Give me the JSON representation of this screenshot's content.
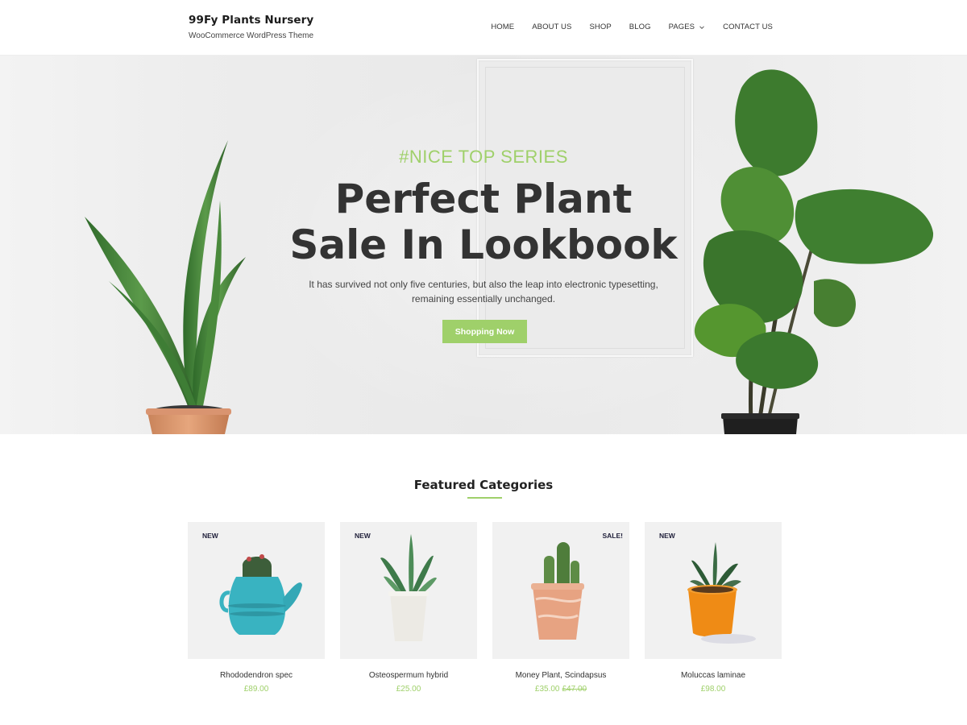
{
  "header": {
    "brand_title": "99Fy Plants Nursery",
    "brand_tagline": "WooCommerce WordPress Theme",
    "nav": [
      {
        "label": "HOME"
      },
      {
        "label": "ABOUT US"
      },
      {
        "label": "SHOP"
      },
      {
        "label": "BLOG"
      },
      {
        "label": "PAGES",
        "has_dropdown": true
      },
      {
        "label": "CONTACT US"
      }
    ]
  },
  "hero": {
    "kicker": "#NICE TOP SERIES",
    "title_line1": "Perfect Plant",
    "title_line2": "Sale In Lookbook",
    "subtitle_line1": "It has survived not only five centuries, but also the leap into electronic typesetting,",
    "subtitle_line2": "remaining essentially unchanged.",
    "button_label": "Shopping Now"
  },
  "featured": {
    "title": "Featured Categories",
    "products": [
      {
        "name": "Rhododendron spec",
        "price": "£89.00",
        "old_price": "",
        "badge": "NEW",
        "badge_side": "left",
        "pot_color": "#39b3c1"
      },
      {
        "name": "Osteospermum hybrid",
        "price": "£25.00",
        "old_price": "",
        "badge": "NEW",
        "badge_side": "left",
        "pot_color": "#eceae4"
      },
      {
        "name": "Money Plant, Scindapsus",
        "price": "£35.00",
        "old_price": "£47.00",
        "badge": "SALE!",
        "badge_side": "right",
        "pot_color": "#e7a382"
      },
      {
        "name": "Moluccas laminae",
        "price": "£98.00",
        "old_price": "",
        "badge": "NEW",
        "badge_side": "left",
        "pot_color": "#ef8b15"
      }
    ]
  },
  "colors": {
    "accent": "#9fd06a",
    "text_dark": "#333333",
    "card_bg": "#f1f1f1"
  }
}
